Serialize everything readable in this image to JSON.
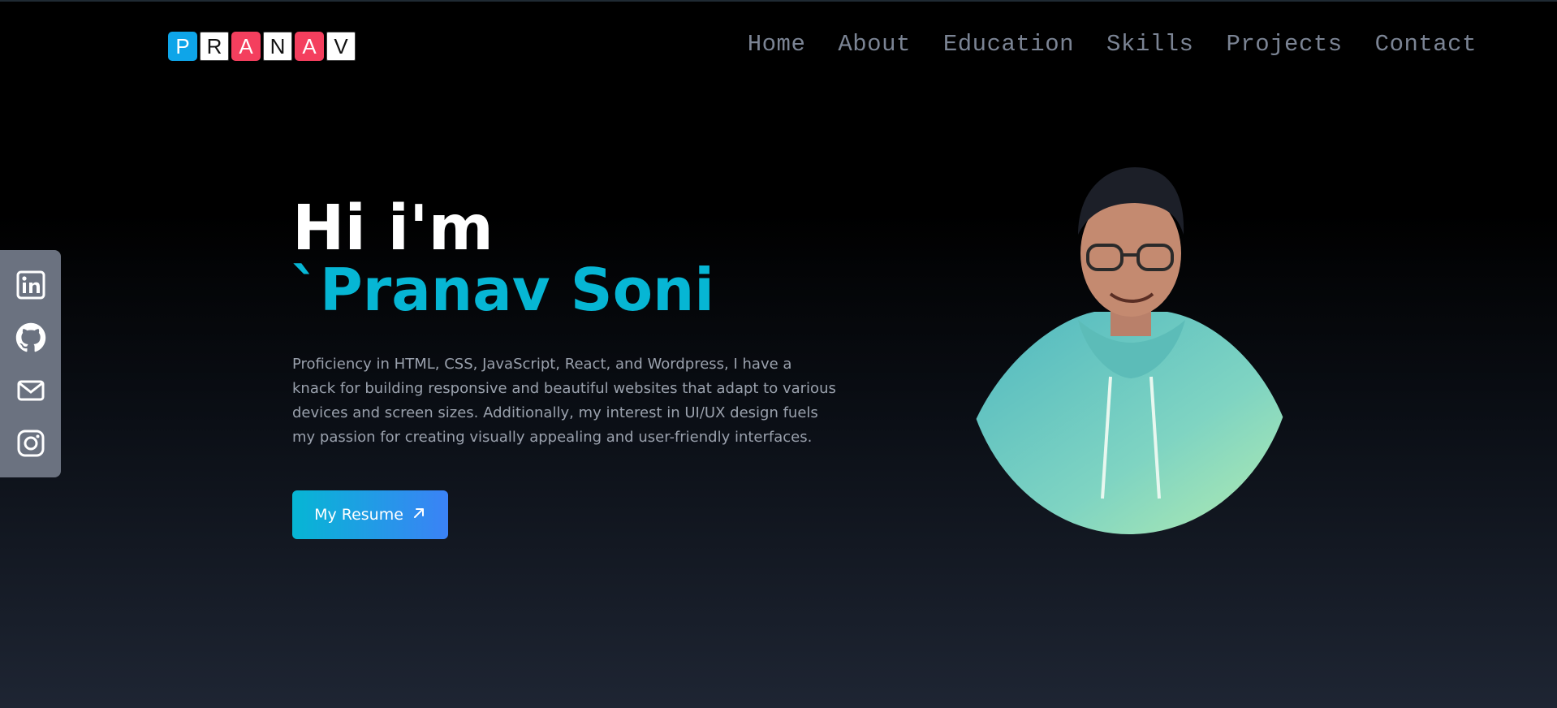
{
  "logo": {
    "letters": [
      "P",
      "R",
      "A",
      "N",
      "A",
      "V"
    ]
  },
  "nav": {
    "home": "Home",
    "about": "About",
    "education": "Education",
    "skills": "Skills",
    "projects": "Projects",
    "contact": "Contact"
  },
  "social": {
    "icons": [
      "linkedin-icon",
      "github-icon",
      "mail-icon",
      "instagram-icon"
    ]
  },
  "hero": {
    "greeting": "Hi i'm",
    "name": "`Pranav Soni",
    "description": "Proficiency in HTML, CSS, JavaScript, React, and Wordpress, I have a knack for building responsive and beautiful websites that adapt to various devices and screen sizes. Additionally, my interest in UI/UX design fuels my passion for creating visually appealing and user-friendly interfaces.",
    "resume_label": "My Resume"
  },
  "colors": {
    "accent": "#06b6d4",
    "button_gradient_end": "#3b82f6",
    "logo_blue": "#0ea5e9",
    "logo_pink": "#f43f5e",
    "sidebar": "#6b7280"
  }
}
